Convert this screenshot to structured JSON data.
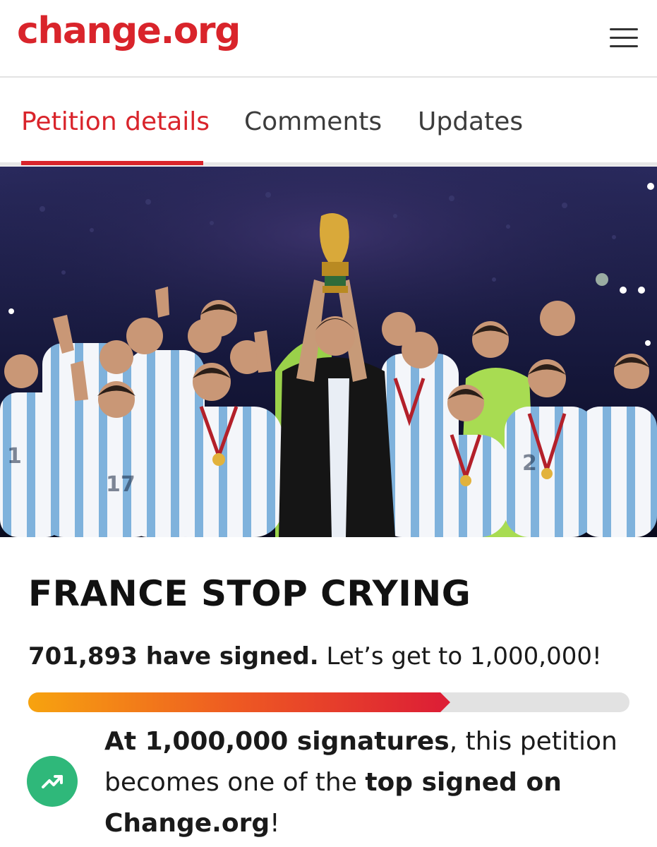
{
  "header": {
    "logo_text": "change.org",
    "brand_color": "#d9242b",
    "menu_icon": "hamburger-menu-icon"
  },
  "tabs": [
    {
      "label": "Petition details",
      "active": true
    },
    {
      "label": "Comments",
      "active": false
    },
    {
      "label": "Updates",
      "active": false
    }
  ],
  "hero": {
    "image_subject": "team-celebrating-with-trophy-photo"
  },
  "petition": {
    "title": "FRANCE STOP CRYING",
    "signed_count": "701,893 have signed.",
    "goal_text": "Let’s get to 1,000,000!",
    "progress_fraction": 0.7019,
    "milestone": {
      "icon": "trending-up-icon",
      "icon_color": "#2fb87a",
      "part1_bold": "At 1,000,000 signatures",
      "part2": ", this petition becomes one of the ",
      "part3_bold": "top signed on Change.org",
      "part4": "!"
    }
  },
  "colors": {
    "progress_start": "#f7a30f",
    "progress_end": "#dd1f35",
    "progress_track": "#e2e2e2"
  }
}
